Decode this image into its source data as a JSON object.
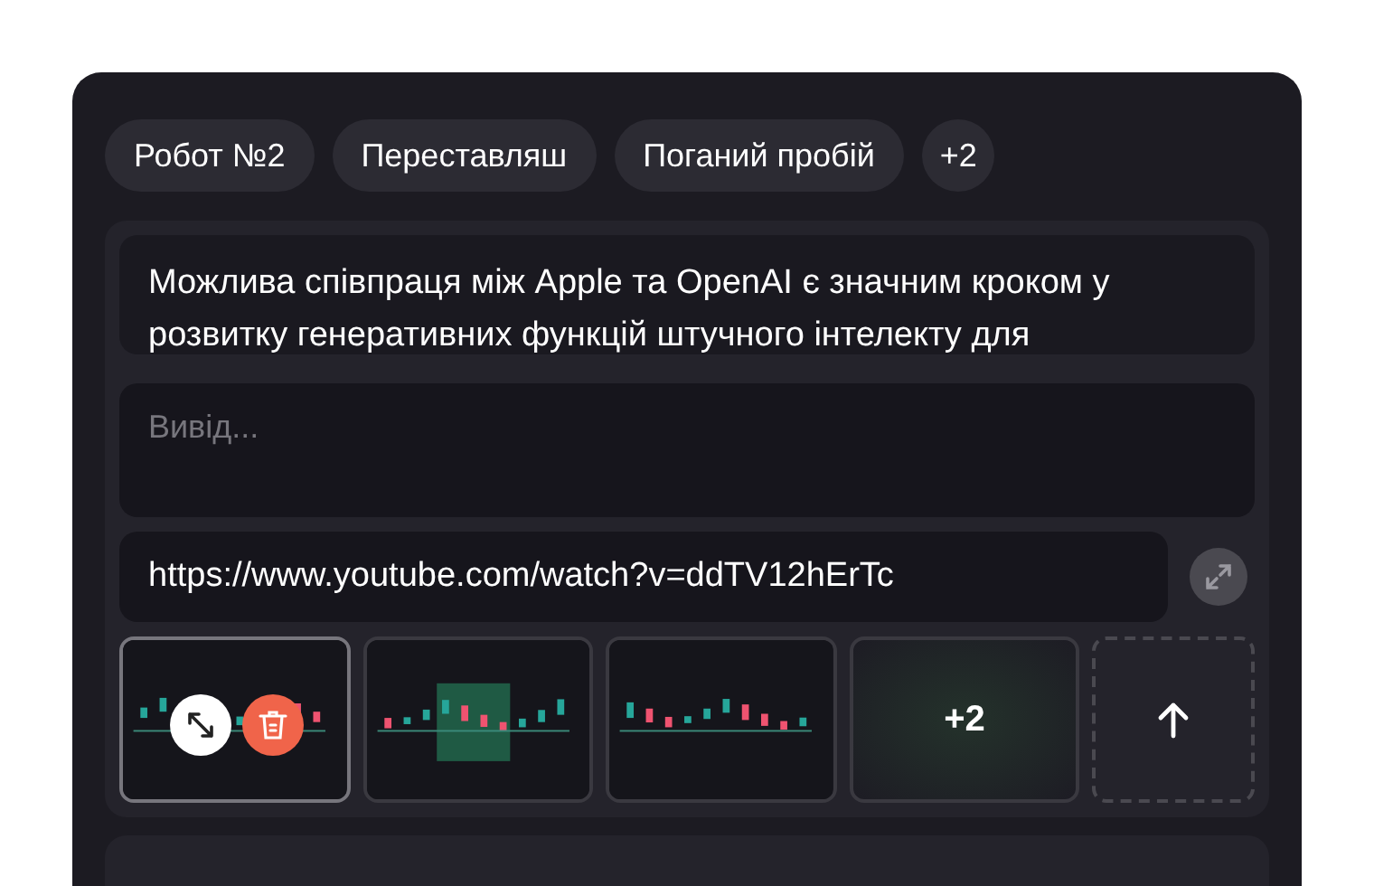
{
  "tags": [
    {
      "label": "Робот №2"
    },
    {
      "label": "Переставляш"
    },
    {
      "label": "Поганий пробій"
    }
  ],
  "more_tags": "+2",
  "message": {
    "value": "Можлива співпраця між Apple та OpenAI є значним кроком у розвитку генеративних функцій штучного інтелекту для"
  },
  "output": {
    "placeholder": "Вивід..."
  },
  "link": {
    "value": "https://www.youtube.com/watch?v=ddTV12hErTc"
  },
  "thumbnails": [
    {
      "kind": "picture",
      "selected": true
    },
    {
      "kind": "picture",
      "selected": false
    },
    {
      "kind": "picture",
      "selected": false
    },
    {
      "kind": "more",
      "label": "+2",
      "selected": false
    },
    {
      "kind": "upload",
      "selected": false
    }
  ]
}
